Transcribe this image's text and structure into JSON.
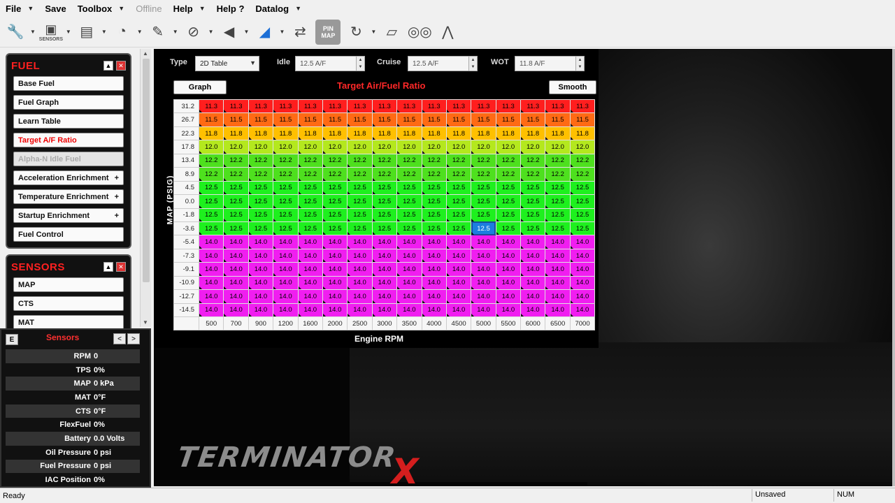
{
  "menu": [
    {
      "label": "File",
      "has_dropdown": true,
      "disabled": false
    },
    {
      "label": "Save",
      "has_dropdown": false,
      "disabled": false
    },
    {
      "label": "Toolbox",
      "has_dropdown": true,
      "disabled": false
    },
    {
      "label": "Offline",
      "has_dropdown": false,
      "disabled": true
    },
    {
      "label": "Help",
      "has_dropdown": true,
      "disabled": false
    },
    {
      "label": "Help ?",
      "has_dropdown": false,
      "disabled": false
    },
    {
      "label": "Datalog",
      "has_dropdown": true,
      "disabled": false
    }
  ],
  "toolbar": {
    "icons": [
      {
        "name": "injector-icon",
        "glyph": "🔧",
        "dropdown": true
      },
      {
        "name": "sensors-icon",
        "glyph": "▣",
        "caption": "SENSORS",
        "dropdown": true
      },
      {
        "name": "efi-module-icon",
        "glyph": "▤",
        "dropdown": true
      },
      {
        "name": "gauge-icon",
        "glyph": "◔",
        "dropdown": true
      },
      {
        "name": "spark-plug-icon",
        "glyph": "✎",
        "dropdown": true
      },
      {
        "name": "throttle-icon",
        "glyph": "⊘",
        "dropdown": true
      },
      {
        "name": "horn-icon",
        "glyph": "◀",
        "dropdown": true
      },
      {
        "name": "ramp-icon",
        "glyph": "◢",
        "dropdown": true
      },
      {
        "name": "io-icon",
        "glyph": "⇄",
        "dropdown": false
      },
      {
        "name": "pin-map-icon",
        "glyph": "PIN\nMAP",
        "dropdown": false
      },
      {
        "name": "refresh-icon",
        "glyph": "↻",
        "dropdown": true
      },
      {
        "name": "notes-icon",
        "glyph": "▱",
        "dropdown": false
      },
      {
        "name": "dashboard-icon",
        "glyph": "◎◎",
        "dropdown": false
      },
      {
        "name": "pulse-icon",
        "glyph": "⋀",
        "dropdown": false
      }
    ]
  },
  "fuel_group": {
    "title": "FUEL",
    "items": [
      {
        "label": "Base Fuel",
        "plus": false,
        "state": "normal"
      },
      {
        "label": "Fuel Graph",
        "plus": false,
        "state": "normal"
      },
      {
        "label": "Learn Table",
        "plus": false,
        "state": "normal"
      },
      {
        "label": "Target A/F Ratio",
        "plus": false,
        "state": "active"
      },
      {
        "label": "Alpha-N Idle Fuel",
        "plus": false,
        "state": "disabled"
      },
      {
        "label": "Acceleration Enrichment",
        "plus": true,
        "state": "normal"
      },
      {
        "label": "Temperature Enrichment",
        "plus": true,
        "state": "normal"
      },
      {
        "label": "Startup Enrichment",
        "plus": true,
        "state": "normal"
      },
      {
        "label": "Fuel Control",
        "plus": false,
        "state": "normal"
      }
    ]
  },
  "sensors_group": {
    "title": "SENSORS",
    "items": [
      {
        "label": "MAP"
      },
      {
        "label": "CTS"
      },
      {
        "label": "MAT"
      }
    ]
  },
  "sensors_panel": {
    "e_label": "E",
    "title": "Sensors",
    "rows": [
      {
        "label": "RPM",
        "value": "0"
      },
      {
        "label": "TPS",
        "value": "0%"
      },
      {
        "label": "MAP",
        "value": "0 kPa"
      },
      {
        "label": "MAT",
        "value": "0°F"
      },
      {
        "label": "CTS",
        "value": "0°F"
      },
      {
        "label": "FlexFuel",
        "value": "0%"
      },
      {
        "label": "Battery",
        "value": "0.0 Volts"
      },
      {
        "label": "Oil Pressure",
        "value": "0 psi"
      },
      {
        "label": "Fuel Pressure",
        "value": "0 psi"
      },
      {
        "label": "IAC Position",
        "value": "0%"
      }
    ]
  },
  "controls": {
    "type_label": "Type",
    "type_value": "2D Table",
    "idle_label": "Idle",
    "idle_value": "12.5 A/F",
    "cruise_label": "Cruise",
    "cruise_value": "12.5 A/F",
    "wot_label": "WOT",
    "wot_value": "11.8 A/F",
    "graph_button": "Graph",
    "smooth_button": "Smooth"
  },
  "table": {
    "title": "Target Air/Fuel Ratio",
    "y_axis_label": "MAP (PSIG)",
    "x_axis_label": "Engine RPM",
    "rpm": [
      "500",
      "700",
      "900",
      "1200",
      "1600",
      "2000",
      "2500",
      "3000",
      "3500",
      "4000",
      "4500",
      "5000",
      "5500",
      "6000",
      "6500",
      "7000"
    ],
    "rows": [
      {
        "map": "31.2",
        "value": "11.3",
        "color": "#ff1e1e"
      },
      {
        "map": "26.7",
        "value": "11.5",
        "color": "#ff6a14"
      },
      {
        "map": "22.3",
        "value": "11.8",
        "color": "#ffc000"
      },
      {
        "map": "17.8",
        "value": "12.0",
        "color": "#b4e81e"
      },
      {
        "map": "13.4",
        "value": "12.2",
        "color": "#4ee01e"
      },
      {
        "map": "8.9",
        "value": "12.2",
        "color": "#4ee01e"
      },
      {
        "map": "4.5",
        "value": "12.5",
        "color": "#1ef01e"
      },
      {
        "map": "0.0",
        "value": "12.5",
        "color": "#1ef01e"
      },
      {
        "map": "-1.8",
        "value": "12.5",
        "color": "#1ef01e"
      },
      {
        "map": "-3.6",
        "value": "12.5",
        "color": "#1ef01e"
      },
      {
        "map": "-5.4",
        "value": "14.0",
        "color": "#f01ef0"
      },
      {
        "map": "-7.3",
        "value": "14.0",
        "color": "#f01ef0"
      },
      {
        "map": "-9.1",
        "value": "14.0",
        "color": "#f01ef0"
      },
      {
        "map": "-10.9",
        "value": "14.0",
        "color": "#f01ef0"
      },
      {
        "map": "-12.7",
        "value": "14.0",
        "color": "#f01ef0"
      },
      {
        "map": "-14.5",
        "value": "14.0",
        "color": "#f01ef0"
      }
    ],
    "selected_cell": {
      "row": 9,
      "col": 11,
      "color": "#1c7ee0"
    }
  },
  "logo": {
    "text": "TERMINATOR",
    "mark": "X"
  },
  "status": {
    "ready": "Ready",
    "unsaved": "Unsaved",
    "num": "NUM"
  }
}
